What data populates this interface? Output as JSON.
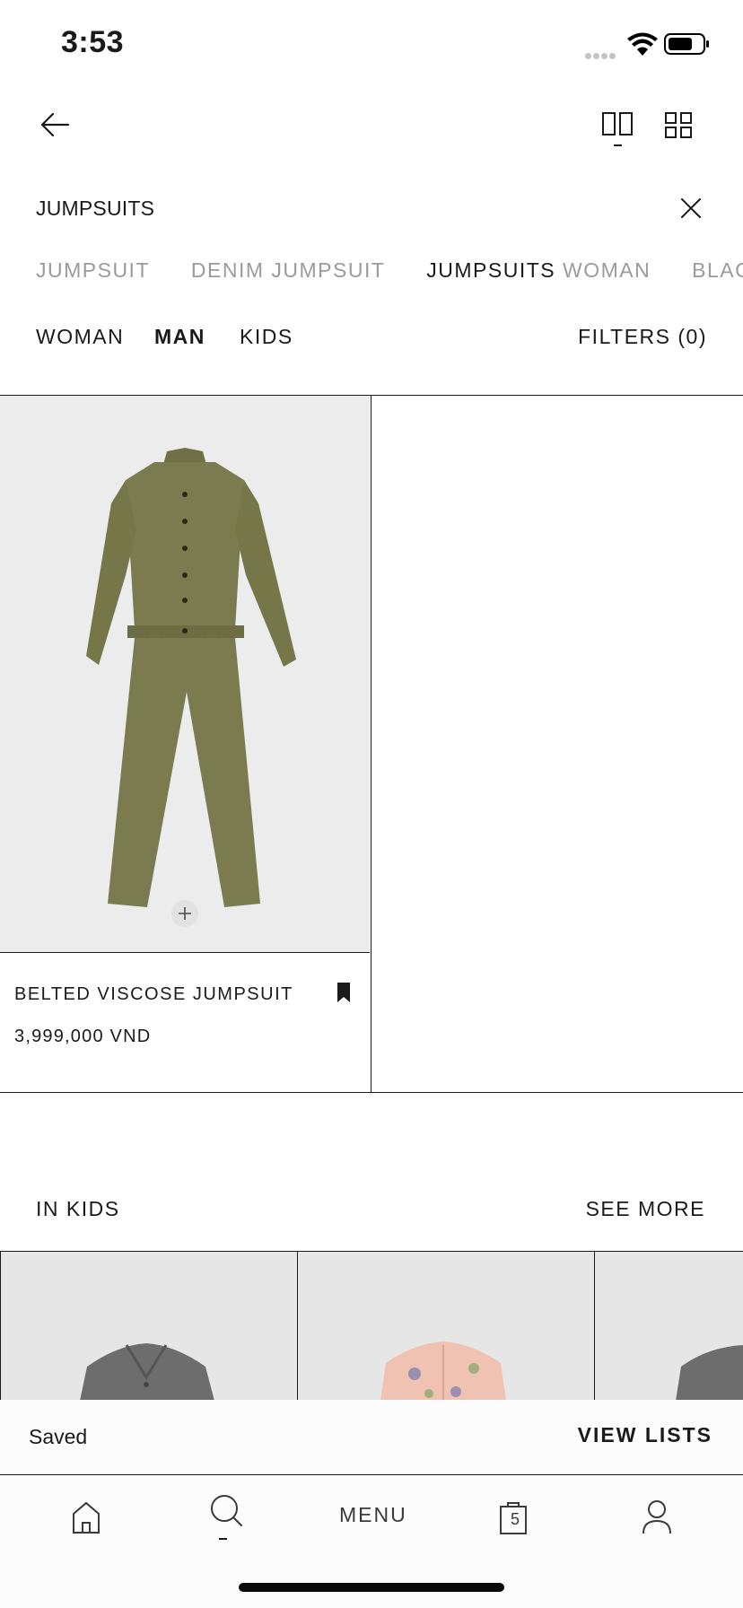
{
  "status_bar": {
    "time": "3:53"
  },
  "search": {
    "query": "JUMPSUITS"
  },
  "suggestions": [
    {
      "highlight": "",
      "rest": "JUMPSUIT"
    },
    {
      "highlight": "",
      "rest": "DENIM JUMPSUIT"
    },
    {
      "highlight": "JUMPSUITS",
      "rest": " WOMAN"
    },
    {
      "highlight": "",
      "rest": "BLACK JUMPSUIT"
    }
  ],
  "tabs": {
    "woman": "WOMAN",
    "man": "MAN",
    "kids": "KIDS",
    "active": "man",
    "filters": "FILTERS (0)"
  },
  "product": {
    "name": "BELTED VISCOSE JUMPSUIT",
    "price": "3,999,000 VND",
    "image_color": "#7a7b4e"
  },
  "kids_section": {
    "title": "IN KIDS",
    "see_more": "SEE MORE"
  },
  "saved_bar": {
    "label": "Saved",
    "action": "VIEW LISTS"
  },
  "bottom_nav": {
    "menu": "MENU",
    "bag_count": "5"
  },
  "icons": {
    "back": "back-arrow-icon",
    "two_column": "two-column-view-icon",
    "four_column": "four-column-view-icon",
    "clear": "close-icon",
    "bookmark": "bookmark-icon",
    "add": "plus-icon",
    "home": "home-icon",
    "search": "search-icon",
    "bag": "shopping-bag-icon",
    "account": "user-icon"
  }
}
